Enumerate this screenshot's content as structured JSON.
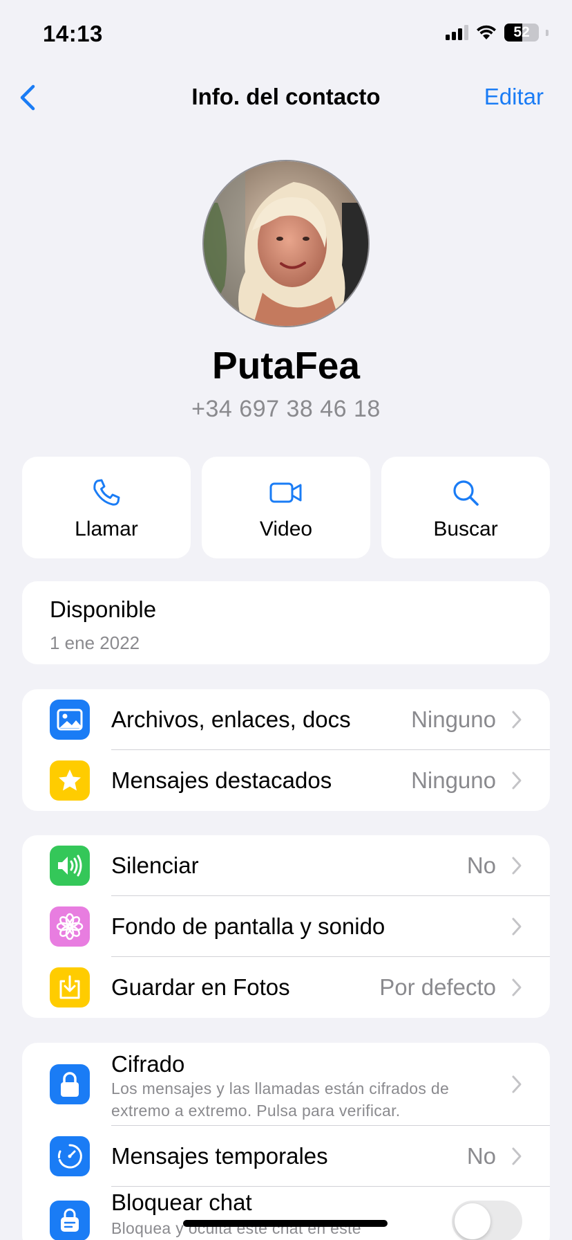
{
  "status_bar": {
    "time": "14:13",
    "battery": "52",
    "battery_level": 0.52
  },
  "nav": {
    "title": "Info. del contacto",
    "edit_label": "Editar"
  },
  "contact": {
    "name": "PutaFea",
    "phone": "+34 697 38 46 18"
  },
  "actions": [
    {
      "label": "Llamar",
      "icon": "phone-icon"
    },
    {
      "label": "Video",
      "icon": "video-camera-icon"
    },
    {
      "label": "Buscar",
      "icon": "search-icon"
    }
  ],
  "about": {
    "text": "Disponible",
    "date": "1 ene 2022"
  },
  "media_section": {
    "items": [
      {
        "label": "Archivos, enlaces, docs",
        "value": "Ninguno",
        "icon": "photo-icon",
        "color": "#1a7cf5"
      },
      {
        "label": "Mensajes destacados",
        "value": "Ninguno",
        "icon": "star-icon",
        "color": "#ffcc00"
      }
    ]
  },
  "settings_section": {
    "items": [
      {
        "label": "Silenciar",
        "value": "No",
        "icon": "speaker-icon",
        "color": "#34c759"
      },
      {
        "label": "Fondo de pantalla y sonido",
        "value": "",
        "icon": "flower-icon",
        "color": "#e87de0"
      },
      {
        "label": "Guardar en Fotos",
        "value": "Por defecto",
        "icon": "download-icon",
        "color": "#ffcc00"
      }
    ]
  },
  "privacy_section": {
    "encryption": {
      "label": "Cifrado",
      "subtitle_line1": "Los mensajes y las llamadas están cifrados de",
      "subtitle_line2": "extremo a extremo. Pulsa para verificar.",
      "icon": "lock-icon",
      "color": "#1a7cf5"
    },
    "disappearing": {
      "label": "Mensajes temporales",
      "value": "No",
      "icon": "timer-icon",
      "color": "#1a7cf5"
    },
    "lock_chat": {
      "label": "Bloquear chat",
      "subtitle": "Bloquea y oculta este chat en este",
      "icon": "chat-lock-icon",
      "color": "#1a7cf5",
      "enabled": false
    }
  },
  "colors": {
    "accent": "#1a7cf5",
    "background": "#f2f2f7",
    "secondary_text": "#8a8a8e"
  }
}
